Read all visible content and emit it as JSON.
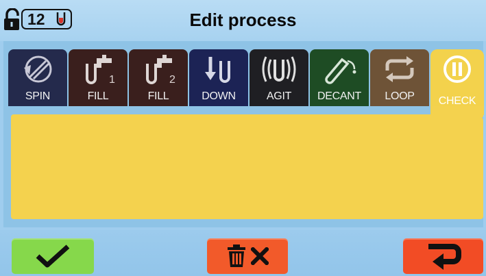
{
  "header": {
    "title": "Edit process",
    "tube_count": "12",
    "icons": [
      "unlock-icon",
      "tube-icon"
    ]
  },
  "tabs": [
    {
      "label": "SPIN",
      "icon": "spin-icon",
      "color": "#242a4c"
    },
    {
      "label": "FILL",
      "badge": "1",
      "icon": "fill-tap-icon",
      "color": "#3a1f1d"
    },
    {
      "label": "FILL",
      "badge": "2",
      "icon": "fill-tap-icon",
      "color": "#3a1f1d"
    },
    {
      "label": "DOWN",
      "icon": "down-icon",
      "color": "#1c2355"
    },
    {
      "label": "AGIT",
      "icon": "agitate-icon",
      "color": "#1f1f23"
    },
    {
      "label": "DECANT",
      "icon": "decant-icon",
      "color": "#1e4c24"
    },
    {
      "label": "LOOP",
      "icon": "loop-icon",
      "color": "#6e5337"
    },
    {
      "label": "CHECK",
      "icon": "pause-icon",
      "color": "#f3d24c",
      "active": true
    }
  ],
  "footer": {
    "confirm_icon": "checkmark-icon",
    "delete_icon": "trash-icon",
    "back_icon": "return-arrow-icon",
    "colors": {
      "confirm": "#86d84b",
      "delete": "#f25a2a",
      "back": "#f24c25"
    }
  }
}
